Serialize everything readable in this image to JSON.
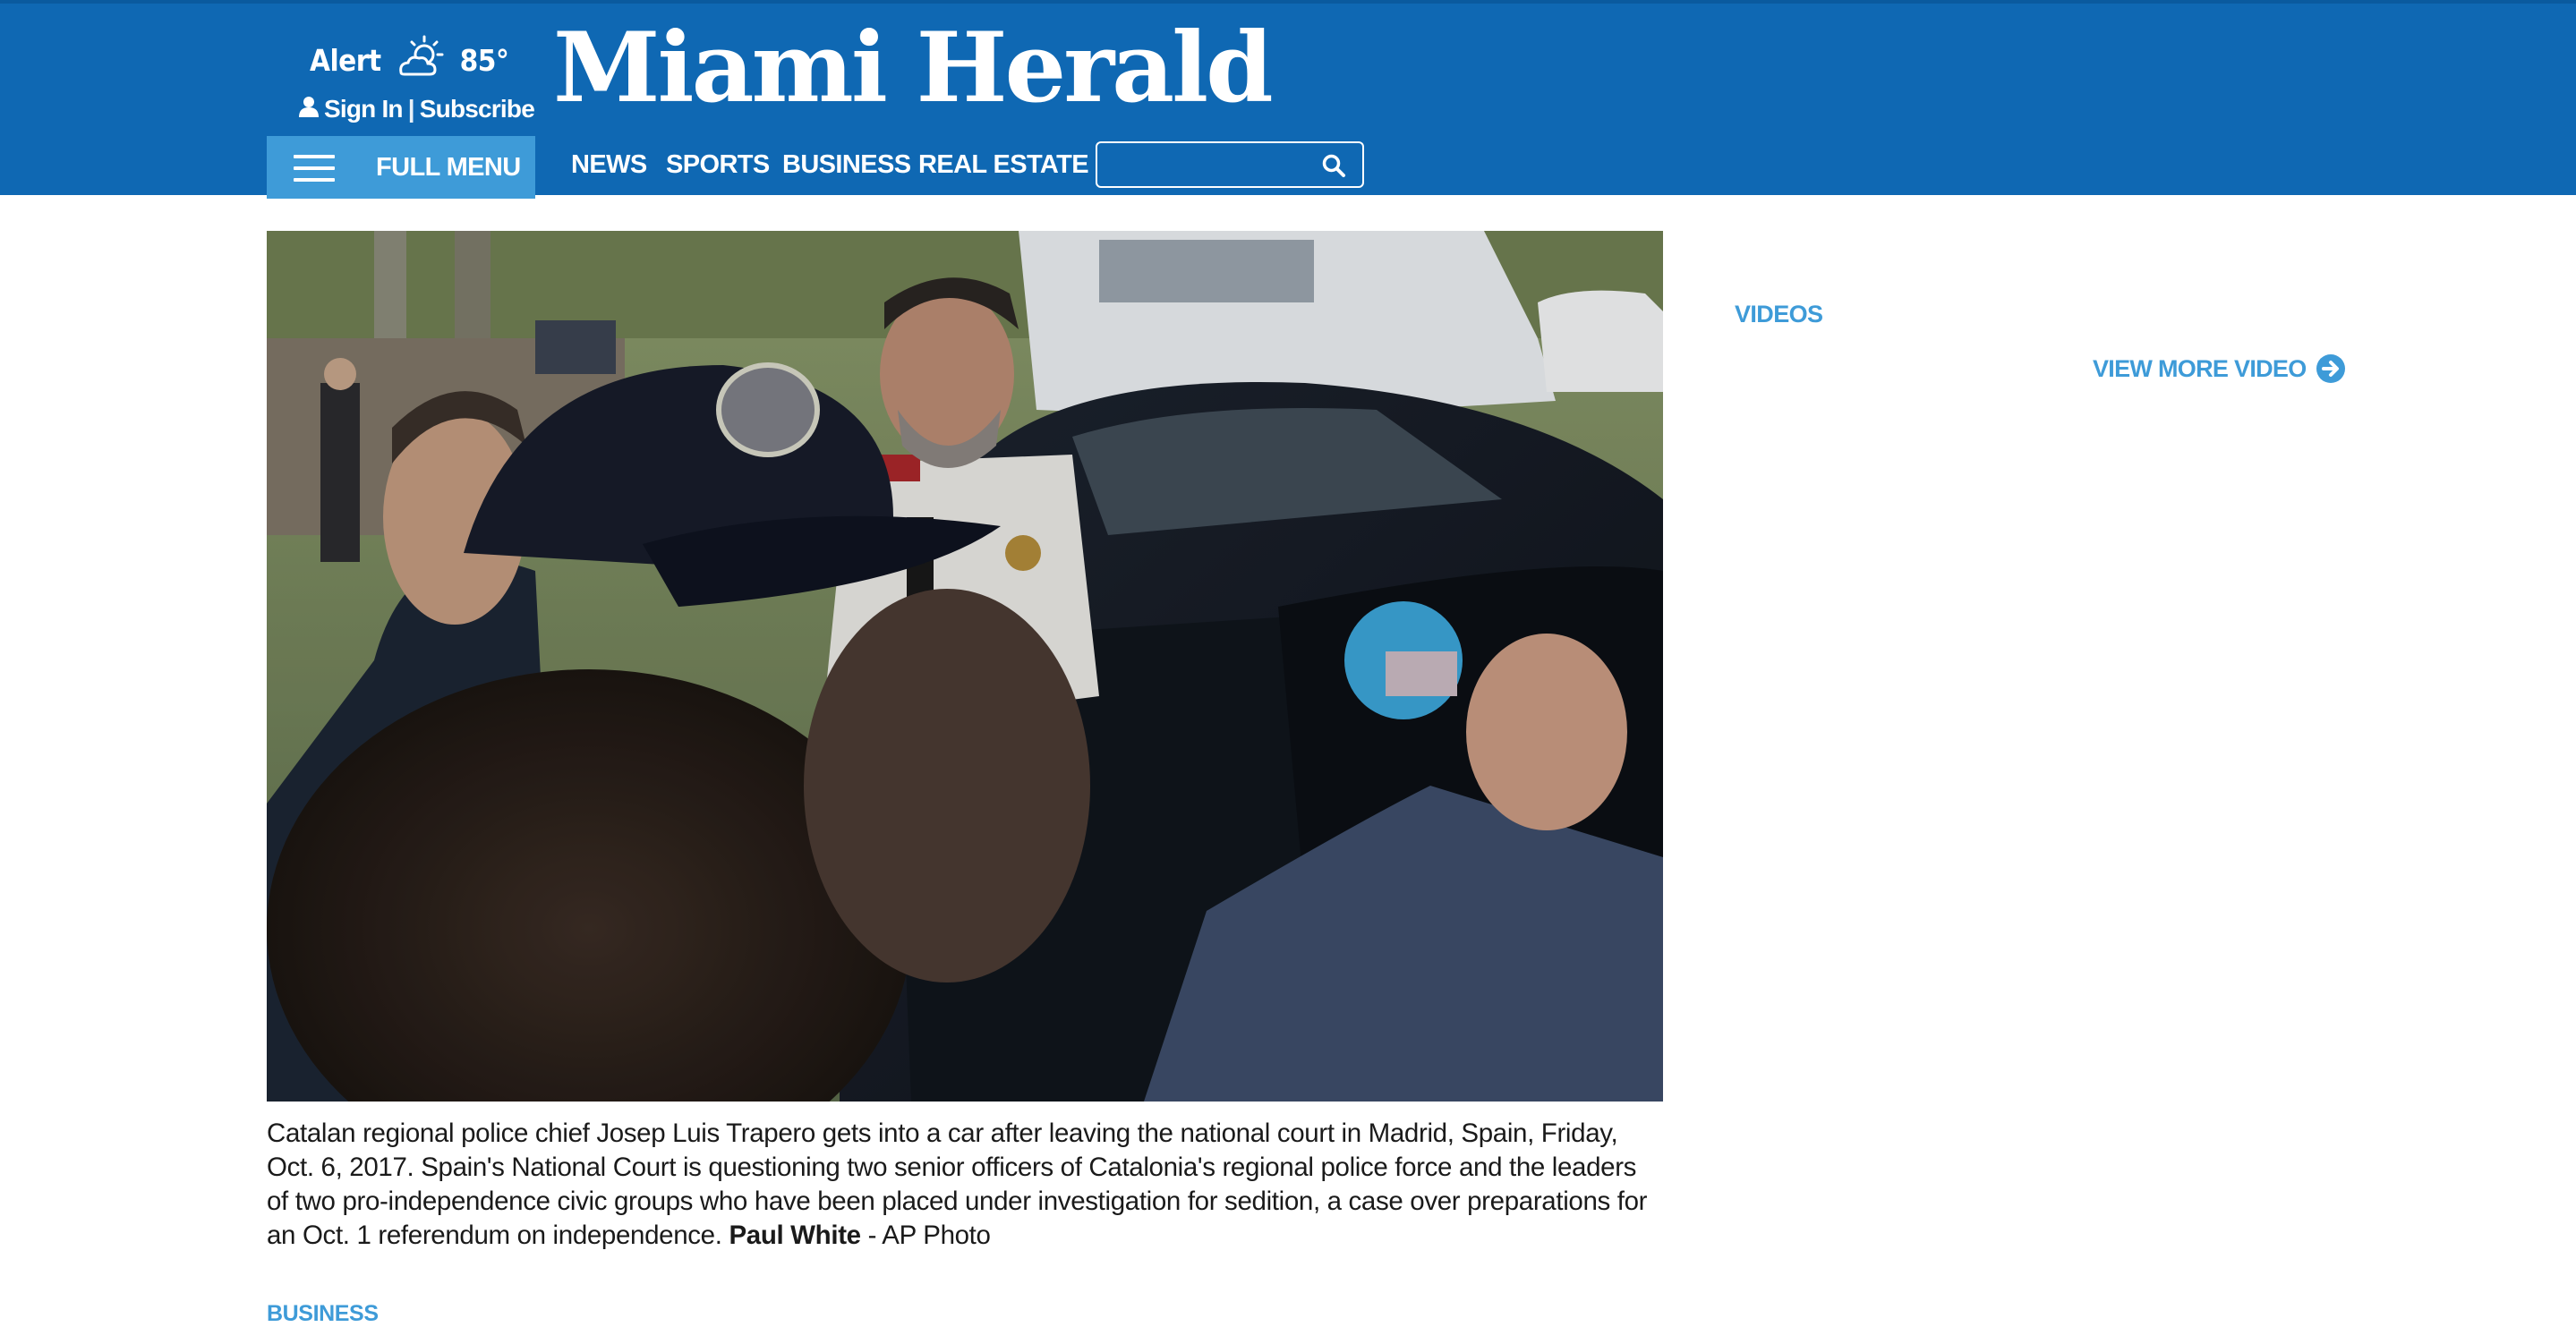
{
  "header": {
    "weather": {
      "alert_label": "Alert",
      "icon": "partly-cloudy-icon",
      "temperature": "85°"
    },
    "account": {
      "icon": "user-icon",
      "sign_in": "Sign In",
      "separator": "|",
      "subscribe": "Subscribe"
    },
    "logo_text": "Miami Herald",
    "nav": {
      "menu_label": "FULL MENU",
      "menu_icon": "hamburger-icon",
      "links": [
        "NEWS",
        "SPORTS",
        "BUSINESS",
        "REAL ESTATE"
      ]
    },
    "search": {
      "value": "",
      "placeholder": "",
      "icon": "search-icon"
    }
  },
  "article": {
    "photo_alt": "Catalan regional police chief Josep Luis Trapero gets into a car",
    "caption": "Catalan regional police chief Josep Luis Trapero gets into a car after leaving the national court in Madrid, Spain, Friday, Oct. 6, 2017. Spain's National Court is questioning two senior officers of Catalonia's regional police force and the leaders of two pro-independence civic groups who have been placed under investigation for sedition, a case over preparations for an Oct. 1 referendum on independence.",
    "credit_name": "Paul White",
    "credit_agency": " - AP Photo",
    "section_tag": "BUSINESS"
  },
  "rail": {
    "videos_heading": "VIDEOS",
    "view_more_label": "VIEW MORE VIDEO",
    "view_more_icon": "arrow-right-circle-icon"
  },
  "colors": {
    "masthead": "#0f68b3",
    "menu_button": "#3e9bd8",
    "accent": "#3e9bd8",
    "text": "#1a1a1a"
  }
}
